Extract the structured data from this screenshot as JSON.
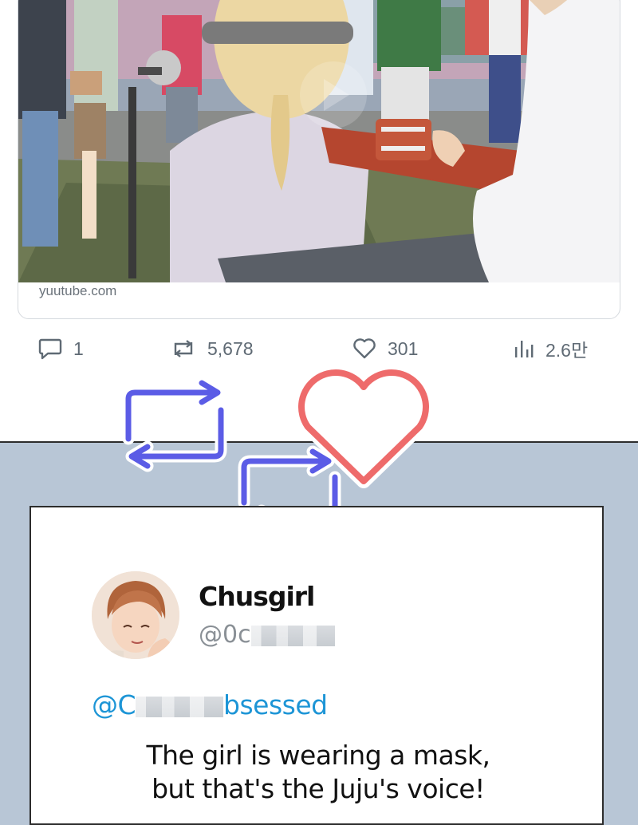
{
  "post": {
    "link_domain": "yuutube.com",
    "stats": {
      "replies": "1",
      "retweets": "5,678",
      "likes": "301",
      "views": "2.6만"
    }
  },
  "tweet": {
    "display_name": "Chusgirl",
    "handle_prefix": "@0c",
    "mention_prefix": "@C",
    "mention_suffix": "bsessed",
    "text_line1": "The girl is wearing a mask,",
    "text_line2": "but that's the Juju's voice!"
  },
  "colors": {
    "retweet_accent": "#5b5ce6",
    "heart_accent": "#ee6b6b",
    "mention_blue": "#1d95d6"
  }
}
